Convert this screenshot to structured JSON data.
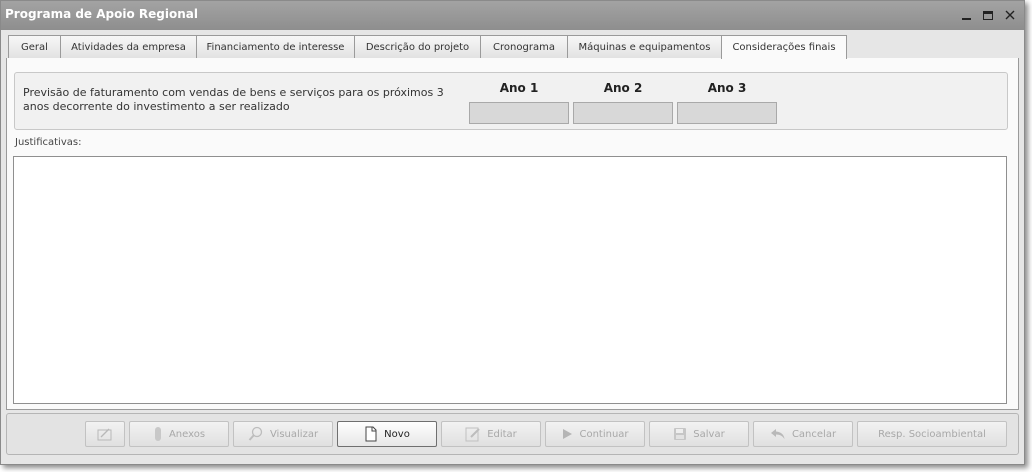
{
  "window": {
    "title": "Programa de Apoio Regional"
  },
  "tabs": [
    {
      "label": "Geral"
    },
    {
      "label": "Atividades da empresa"
    },
    {
      "label": "Financiamento de interesse"
    },
    {
      "label": "Descrição do projeto"
    },
    {
      "label": "Cronograma"
    },
    {
      "label": "Máquinas e equipamentos"
    },
    {
      "label": "Considerações finais",
      "active": true
    }
  ],
  "forecast": {
    "label": "Previsão de faturamento com vendas de bens e serviços para os próximos 3 anos decorrente do investimento a ser realizado",
    "years": [
      {
        "title": "Ano 1",
        "value": ""
      },
      {
        "title": "Ano 2",
        "value": ""
      },
      {
        "title": "Ano 3",
        "value": ""
      }
    ]
  },
  "justification": {
    "label": "Justificativas:",
    "value": ""
  },
  "toolbar": {
    "buttons": [
      {
        "label": "",
        "icon": "signature-icon",
        "enabled": false
      },
      {
        "label": "Anexos",
        "icon": "paperclip-icon",
        "enabled": false
      },
      {
        "label": "Visualizar",
        "icon": "magnifier-icon",
        "enabled": false
      },
      {
        "label": "Novo",
        "icon": "new-document-icon",
        "enabled": true
      },
      {
        "label": "Editar",
        "icon": "pencil-icon",
        "enabled": false
      },
      {
        "label": "Continuar",
        "icon": "play-icon",
        "enabled": false
      },
      {
        "label": "Salvar",
        "icon": "floppy-icon",
        "enabled": false
      },
      {
        "label": "Cancelar",
        "icon": "undo-arrow-icon",
        "enabled": false
      },
      {
        "label": "Resp. Socioambiental",
        "icon": "",
        "enabled": false
      }
    ]
  },
  "colors": {
    "titlebar": "#999999",
    "panel": "#e6e6e6",
    "content": "#fafafa"
  }
}
